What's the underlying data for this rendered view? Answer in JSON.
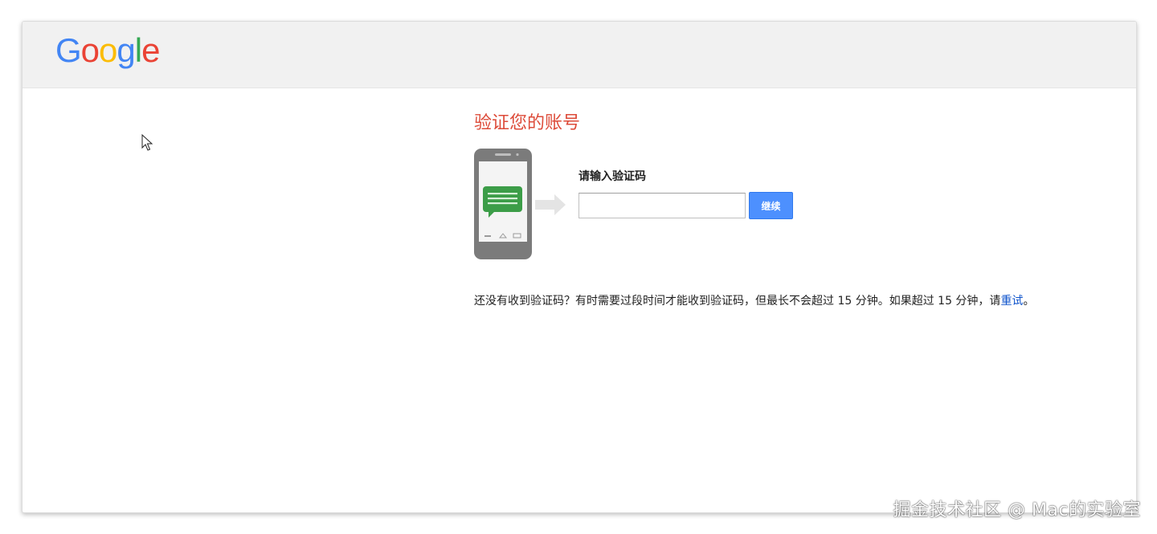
{
  "header": {
    "logo_letters": [
      "G",
      "o",
      "o",
      "g",
      "l",
      "e"
    ],
    "logo_colors": [
      "#4285f4",
      "#ea4335",
      "#fbbc05",
      "#4285f4",
      "#34a853",
      "#ea4335"
    ]
  },
  "main": {
    "title": "验证您的账号",
    "code_label": "请输入验证码",
    "code_input_value": "",
    "continue_label": "继续",
    "hint_text": "还没有收到验证码？有时需要过段时间才能收到验证码，但最长不会超过 15 分钟。如果超过 15 分钟，请",
    "retry_link": "重试",
    "hint_end": "。"
  },
  "colors": {
    "title": "#dd4b39",
    "button": "#4d90fe",
    "link": "#1155cc",
    "message_bubble": "#3c9d48"
  },
  "icons": {
    "phone": "phone-sms-icon",
    "arrow": "arrow-right-icon",
    "cursor": "mouse-pointer-icon"
  },
  "watermark": "掘金技术社区 @ Mac的实验室"
}
